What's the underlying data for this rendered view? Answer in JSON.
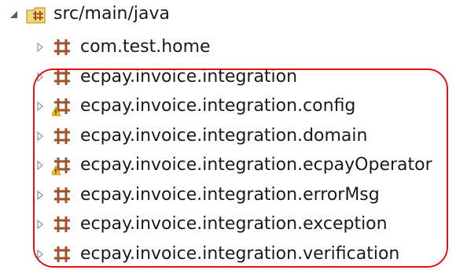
{
  "tree": {
    "root": {
      "label": "src/main/java",
      "icon": "source-folder-icon",
      "expanded": true
    },
    "packages": [
      {
        "label": "com.test.home",
        "warning": false
      },
      {
        "label": "ecpay.invoice.integration",
        "warning": false
      },
      {
        "label": "ecpay.invoice.integration.config",
        "warning": true
      },
      {
        "label": "ecpay.invoice.integration.domain",
        "warning": false
      },
      {
        "label": "ecpay.invoice.integration.ecpayOperator",
        "warning": true
      },
      {
        "label": "ecpay.invoice.integration.errorMsg",
        "warning": false
      },
      {
        "label": "ecpay.invoice.integration.exception",
        "warning": false
      },
      {
        "label": "ecpay.invoice.integration.verification",
        "warning": false
      }
    ]
  },
  "colors": {
    "package": "#a0522d",
    "warning": "#f2c21a",
    "highlight": "#e0121b",
    "twisty": "#9a9a9a"
  }
}
